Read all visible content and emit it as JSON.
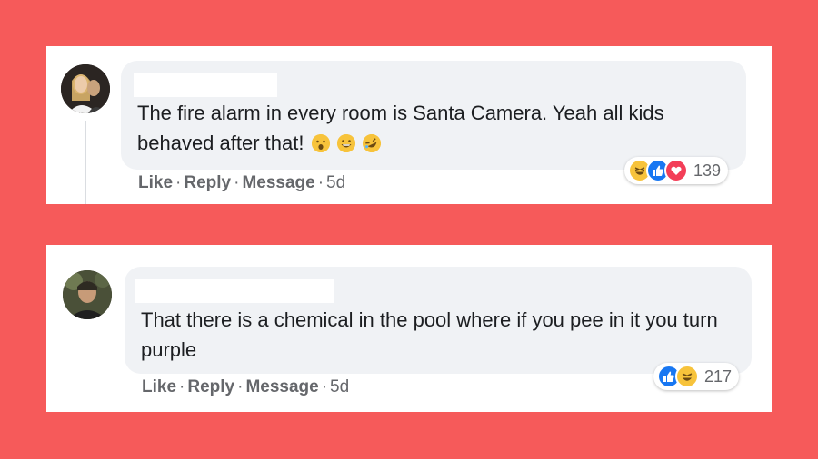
{
  "comments": [
    {
      "text": "The fire alarm in every room is Santa Camera. Yeah all kids behaved after that!",
      "actions": {
        "like": "Like",
        "reply": "Reply",
        "message": "Message",
        "time": "5d"
      },
      "reaction_count": "139",
      "reaction_icons": [
        "haha-icon",
        "like-icon",
        "love-icon"
      ],
      "inline_emojis": [
        "astonished-emoji-icon",
        "grinning-emoji-icon",
        "rofl-emoji-icon"
      ]
    },
    {
      "text": "That there is a chemical in the pool where if you pee in it you turn purple",
      "actions": {
        "like": "Like",
        "reply": "Reply",
        "message": "Message",
        "time": "5d"
      },
      "reaction_count": "217",
      "reaction_icons": [
        "like-icon",
        "haha-icon"
      ]
    }
  ],
  "colors": {
    "background": "#f65a5a",
    "bubble": "#f0f2f5",
    "like_blue": "#1877f2",
    "love_red": "#f33e58",
    "haha_yellow": "#f7c33b",
    "meta_gray": "#65676b"
  }
}
